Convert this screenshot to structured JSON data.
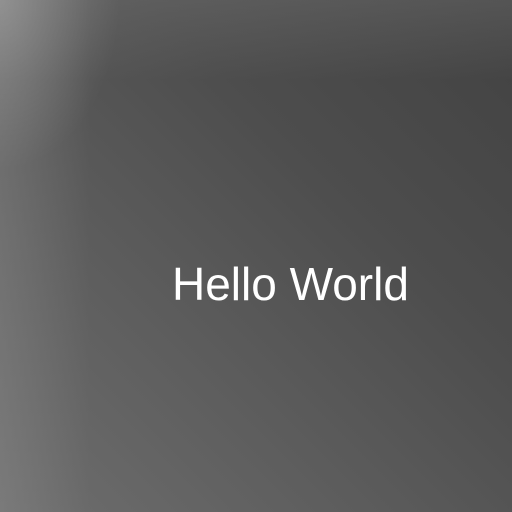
{
  "message": "Hello World",
  "colors": {
    "text": "#ffffff",
    "background_dark": "#424242",
    "background_light": "#6e6e6e"
  }
}
